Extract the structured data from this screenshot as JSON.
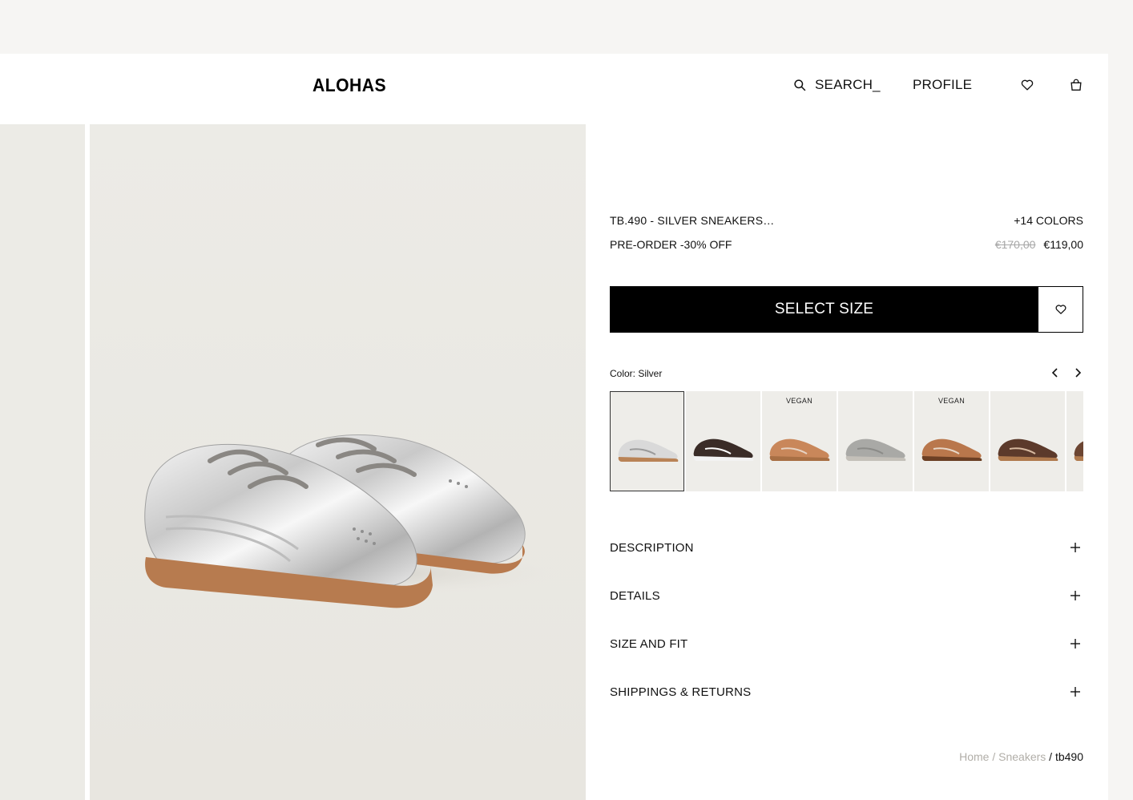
{
  "header": {
    "logo": "ALOHAS",
    "search_label": "SEARCH_",
    "profile_label": "PROFILE"
  },
  "product": {
    "title": "TB.490 - SILVER SNEAKERS…",
    "colors_count": "+14 COLORS",
    "promo": "PRE-ORDER -30% OFF",
    "old_price": "€170,00",
    "price": "€119,00",
    "select_size_label": "SELECT SIZE",
    "color_label": "Color: Silver"
  },
  "swatches": [
    {
      "tag": "",
      "upper": "#d9d9d9",
      "sole": "#b98356",
      "accent": "#9a9a9a"
    },
    {
      "tag": "",
      "upper": "#3a2c27",
      "sole": "#f2f2f2",
      "accent": "#ffffff"
    },
    {
      "tag": "VEGAN",
      "upper": "#c9875a",
      "sole": "#a86f44",
      "accent": "#e6d3c3"
    },
    {
      "tag": "",
      "upper": "#a9a9a6",
      "sole": "#c4c0b9",
      "accent": "#8b8b88"
    },
    {
      "tag": "VEGAN",
      "upper": "#b9774c",
      "sole": "#6b3f24",
      "accent": "#e7d7c8"
    },
    {
      "tag": "",
      "upper": "#5c3a2b",
      "sole": "#b07a4e",
      "accent": "#d7b9a0"
    },
    {
      "tag": "",
      "upper": "#6c4532",
      "sole": "#b07a4e",
      "accent": "#d1b9a2"
    }
  ],
  "accordion": [
    {
      "label": "DESCRIPTION"
    },
    {
      "label": "DETAILS"
    },
    {
      "label": "SIZE AND FIT"
    },
    {
      "label": "SHIPPINGS & RETURNS"
    }
  ],
  "breadcrumb": {
    "home": "Home",
    "sep1": " / ",
    "category": "Sneakers",
    "sep2": " / ",
    "current": "tb490"
  }
}
